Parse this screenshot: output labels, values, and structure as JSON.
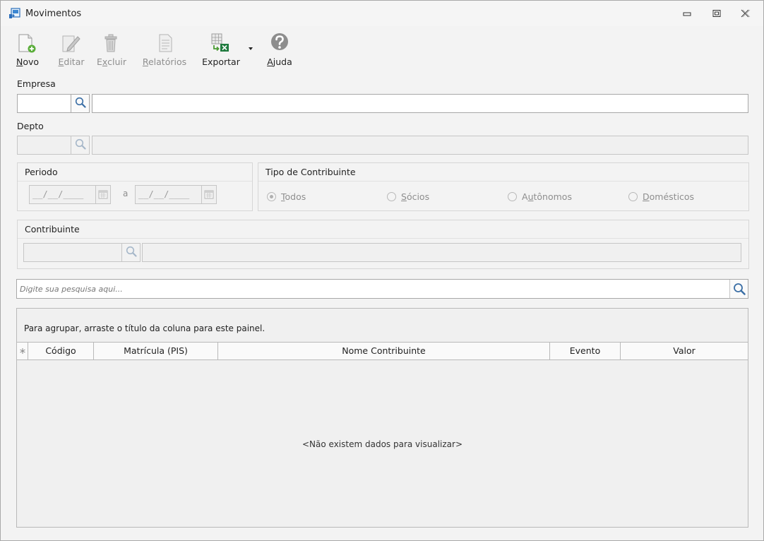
{
  "window": {
    "title": "Movimentos",
    "icon": "app-window-icon",
    "controls": [
      "minimize-icon",
      "restore-icon",
      "close-icon"
    ]
  },
  "toolbar": {
    "novo": {
      "pre": "",
      "key": "N",
      "post": "ovo",
      "icon": "new-document-icon",
      "enabled": true
    },
    "editar": {
      "pre": "",
      "key": "E",
      "post": "ditar",
      "icon": "edit-pencil-icon",
      "enabled": false
    },
    "excluir": {
      "pre": "E",
      "key": "x",
      "post": "cluir",
      "icon": "trash-icon",
      "enabled": false
    },
    "relatorios": {
      "pre": "",
      "key": "R",
      "post": "elatórios",
      "icon": "report-icon",
      "enabled": false
    },
    "exportar": {
      "pre": "Exportar",
      "key": "",
      "post": "",
      "icon": "export-excel-icon",
      "enabled": true
    },
    "ajuda": {
      "pre": "",
      "key": "A",
      "post": "juda",
      "icon": "help-icon",
      "enabled": true
    }
  },
  "empresa": {
    "label": "Empresa",
    "code": "",
    "name": ""
  },
  "depto": {
    "label": "Depto",
    "code": "",
    "name": ""
  },
  "periodo": {
    "title": "Periodo",
    "from": "__/__/____",
    "separator": "a",
    "to": "__/__/____"
  },
  "tipo_contribuinte": {
    "title": "Tipo de Contribuinte",
    "options": [
      {
        "key": "T",
        "rest": "odos",
        "selected": true
      },
      {
        "key": "S",
        "rest": "ócios",
        "selected": false
      },
      {
        "pre": "A",
        "key": "u",
        "rest": "tônomos",
        "selected": false
      },
      {
        "key": "D",
        "rest": "omésticos",
        "selected": false
      }
    ]
  },
  "contribuinte": {
    "title": "Contribuinte",
    "code": "",
    "name": ""
  },
  "search": {
    "placeholder": "Digite sua pesquisa aqui...",
    "value": ""
  },
  "grid": {
    "group_panel_text": "Para agrupar, arraste o título da coluna para este painel.",
    "columns": [
      "Código",
      "Matrícula (PIS)",
      "Nome Contribuinte",
      "Evento",
      "Valor"
    ],
    "rows": [],
    "empty_text": "<Não existem dados para visualizar>"
  },
  "colors": {
    "accent": "#1e73be",
    "disabled_text": "#8e8e8e",
    "border": "#a8a8a8"
  }
}
